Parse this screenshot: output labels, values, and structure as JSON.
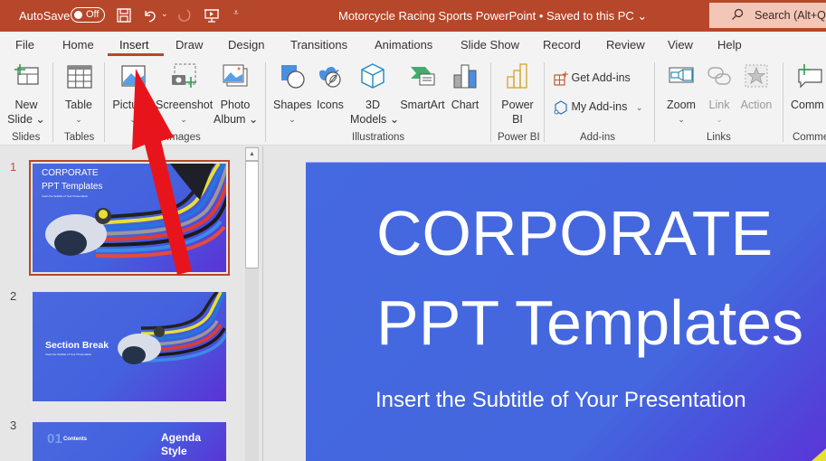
{
  "titlebar": {
    "autosave_label": "AutoSave",
    "autosave_state": "Off",
    "quick_access": [
      "save-icon",
      "undo-icon",
      "undo-dropdown-icon",
      "redo-icon",
      "present-from-start-icon",
      "customize-quick-access-icon"
    ],
    "document_title": "Motorcycle Racing Sports PowerPoint  •  Saved to this PC ⌄",
    "search_placeholder": "Search (Alt+Q)",
    "accent_color": "#b7472a"
  },
  "tabs": [
    {
      "label": "File"
    },
    {
      "label": "Home"
    },
    {
      "label": "Insert",
      "active": true
    },
    {
      "label": "Draw"
    },
    {
      "label": "Design"
    },
    {
      "label": "Transitions"
    },
    {
      "label": "Animations"
    },
    {
      "label": "Slide Show"
    },
    {
      "label": "Record"
    },
    {
      "label": "Review"
    },
    {
      "label": "View"
    },
    {
      "label": "Help"
    }
  ],
  "ribbon": {
    "groups": [
      {
        "label": "Slides",
        "buttons": [
          {
            "line1": "New",
            "line2": "Slide ⌄"
          }
        ]
      },
      {
        "label": "Tables",
        "buttons": [
          {
            "line1": "Table",
            "line2": "⌄"
          }
        ]
      },
      {
        "label": "Images",
        "buttons": [
          {
            "line1": "Pictures",
            "line2": "⌄"
          },
          {
            "line1": "Screenshot",
            "line2": "⌄"
          },
          {
            "line1": "Photo",
            "line2": "Album ⌄"
          }
        ]
      },
      {
        "label": "Illustrations",
        "buttons": [
          {
            "line1": "Shapes",
            "line2": "⌄"
          },
          {
            "line1": "Icons",
            "line2": ""
          },
          {
            "line1": "3D",
            "line2": "Models ⌄"
          },
          {
            "line1": "SmartArt",
            "line2": ""
          },
          {
            "line1": "Chart",
            "line2": ""
          }
        ]
      },
      {
        "label": "Power BI",
        "buttons": [
          {
            "line1": "Power",
            "line2": "BI"
          }
        ]
      },
      {
        "label": "Add-ins",
        "buttons": [
          {
            "line1": "Get Add-ins"
          },
          {
            "line1": "My Add-ins",
            "line2": "⌄"
          }
        ]
      },
      {
        "label": "Links",
        "buttons": [
          {
            "line1": "Zoom",
            "line2": "⌄"
          },
          {
            "line1": "Link",
            "line2": "⌄",
            "disabled": true
          },
          {
            "line1": "Action",
            "disabled": true
          }
        ]
      },
      {
        "label": "Comme",
        "buttons": [
          {
            "line1": "Comm"
          }
        ]
      }
    ]
  },
  "slides_panel": {
    "slides": [
      {
        "number": "1",
        "selected": true,
        "title_line1": "CORPORATE",
        "title_line2": "PPT Templates",
        "subtitle": "Insert the Subtitle of Your Presentation"
      },
      {
        "number": "2",
        "title_line1": "Section Break",
        "subtitle": "Insert the Subtitle of Your Presentation"
      },
      {
        "number": "3",
        "item_number": "01",
        "item_label": "Contents",
        "title_line1": "Agenda",
        "title_line2": "Style"
      }
    ]
  },
  "main_slide": {
    "title_line1": "CORPORATE",
    "title_line2": "PPT Templates",
    "subtitle": "Insert the Subtitle of Your Presentation"
  },
  "annotation": {
    "type": "red-arrow",
    "points_to": "Insert tab",
    "color": "#e8141c"
  }
}
